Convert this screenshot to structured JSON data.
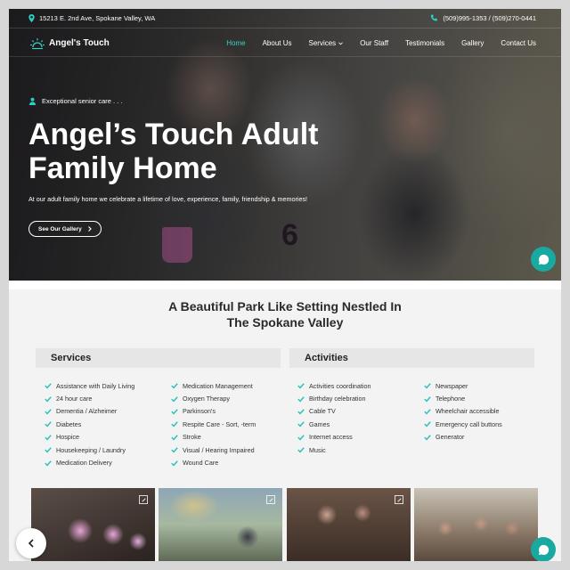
{
  "topbar": {
    "address": "15213 E. 2nd Ave, Spokane Valley, WA",
    "phones": "(509)995-1353 / (509)270-0441"
  },
  "nav": {
    "logo": "Angel's Touch",
    "items": [
      "Home",
      "About Us",
      "Services",
      "Our Staff",
      "Testimonials",
      "Gallery",
      "Contact Us"
    ]
  },
  "hero": {
    "tagline": "Exceptional senior care . . .",
    "title_line1": "Angel’s Touch Adult",
    "title_line2": "Family Home",
    "subtitle": "At our adult family home we celebrate a lifetime of love, experience, family, friendship & memories!",
    "button": "See Our Gallery",
    "photo_jersey_number": "6"
  },
  "section": {
    "title_line1": "A Beautiful Park Like Setting Nestled In",
    "title_line2": "The Spokane Valley",
    "services_heading": "Services",
    "activities_heading": "Activities",
    "services_col1": [
      "Assistance with Daily Living",
      "24 hour care",
      "Dementia / Alzheimer",
      "Diabetes",
      "Hospice",
      "Housekeeping / Laundry",
      "Medication Delivery"
    ],
    "services_col2": [
      "Medication Management",
      "Oxygen Therapy",
      "Parkinson's",
      "Respite Care - Sort, -term",
      "Stroke",
      "Visual / Hearing Impaired",
      "Wound Care"
    ],
    "activities_col1": [
      "Activities coordination",
      "Birthday celebration",
      "Cable TV",
      "Games",
      "Internet access",
      "Music"
    ],
    "activities_col2": [
      "Newspaper",
      "Telephone",
      "Wheelchair accessible",
      "Emergency call buttons",
      "Generator"
    ]
  },
  "colors": {
    "accent": "#2bd0c4",
    "chat": "#19a9a0",
    "check": "#2bc2bb"
  },
  "icons": [
    "map-pin-icon",
    "phone-icon",
    "sun-logo-icon",
    "person-icon",
    "chevron-right-icon",
    "chat-icon",
    "check-icon",
    "expand-icon",
    "chevron-left-icon"
  ]
}
